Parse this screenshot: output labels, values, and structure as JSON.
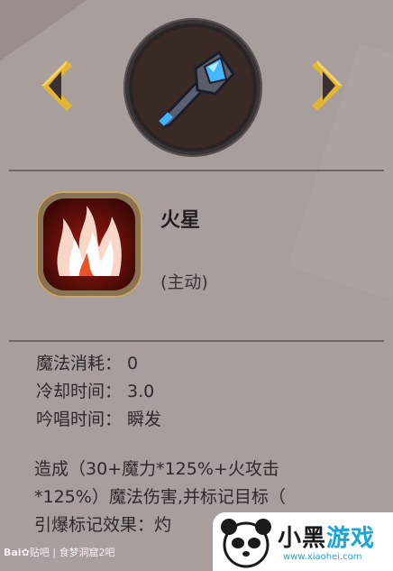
{
  "skill": {
    "name": "火星",
    "type": "(主动)"
  },
  "stats": [
    {
      "label": "魔法消耗：",
      "value": "0"
    },
    {
      "label": "冷却时间：",
      "value": "3.0"
    },
    {
      "label": "吟唱时间：",
      "value": "瞬发"
    }
  ],
  "description": [
    "造成（30+魔力*125%+火攻击",
    "*125%）魔法伤害,并标记目标（",
    "引爆标记效果：灼"
  ],
  "watermark": {
    "baidu": "Bai",
    "tieba": "贴吧",
    "forum": "|  食梦洞窟2吧"
  },
  "logo": {
    "text_main": "小黑",
    "text_accent": "游戏",
    "url": "www.xiaohei.com"
  },
  "colors": {
    "background": "#a89e9c",
    "frame_gold": "#c9a66b",
    "fire_red": "#9b1c12",
    "arrow_gold": "#e2b632"
  }
}
